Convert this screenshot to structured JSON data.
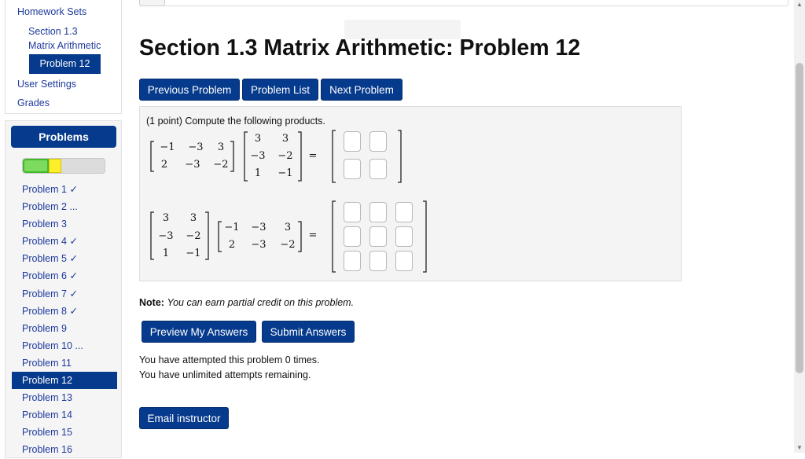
{
  "sidebar": {
    "nav": {
      "homework_sets": "Homework Sets",
      "section_line1": "Section 1.3",
      "section_line2": "Matrix Arithmetic",
      "current_problem": "Problem 12",
      "user_settings": "User Settings",
      "grades": "Grades"
    },
    "problems_header": "Problems",
    "progress": {
      "correct_fraction": 0.32,
      "partial_fraction": 0.15,
      "colors": {
        "correct": "#7ddc5f",
        "partial": "#ffef2a"
      }
    },
    "problems": [
      "Problem 1 ✓",
      "Problem 2 ...",
      "Problem 3",
      "Problem 4 ✓",
      "Problem 5 ✓",
      "Problem 6 ✓",
      "Problem 7 ✓",
      "Problem 8 ✓",
      "Problem 9",
      "Problem 10 ...",
      "Problem 11",
      "Problem 12",
      "Problem 13",
      "Problem 14",
      "Problem 15",
      "Problem 16"
    ],
    "active_index": 11
  },
  "main": {
    "title": "Section 1.3 Matrix Arithmetic: Problem 12",
    "nav_buttons": {
      "previous": "Previous Problem",
      "list": "Problem List",
      "next": "Next Problem"
    },
    "statement": "(1 point) Compute the following products.",
    "math": {
      "matrix_a": [
        [
          "−1",
          "−3",
          "3"
        ],
        [
          "2",
          "−3",
          "−2"
        ]
      ],
      "matrix_b": [
        [
          "3",
          "3"
        ],
        [
          "−3",
          "−2"
        ],
        [
          "1",
          "−1"
        ]
      ],
      "equals": "="
    },
    "note_label": "Note:",
    "note_text": "You can earn partial credit on this problem.",
    "action_buttons": {
      "preview": "Preview My Answers",
      "submit": "Submit Answers"
    },
    "attempts_msg": "You have attempted this problem 0 times.",
    "remaining_msg": "You have unlimited attempts remaining.",
    "email_button": "Email instructor"
  },
  "colors": {
    "accent": "#063a8d",
    "link": "#1f3b9c",
    "panel": "#f4f4f4"
  }
}
